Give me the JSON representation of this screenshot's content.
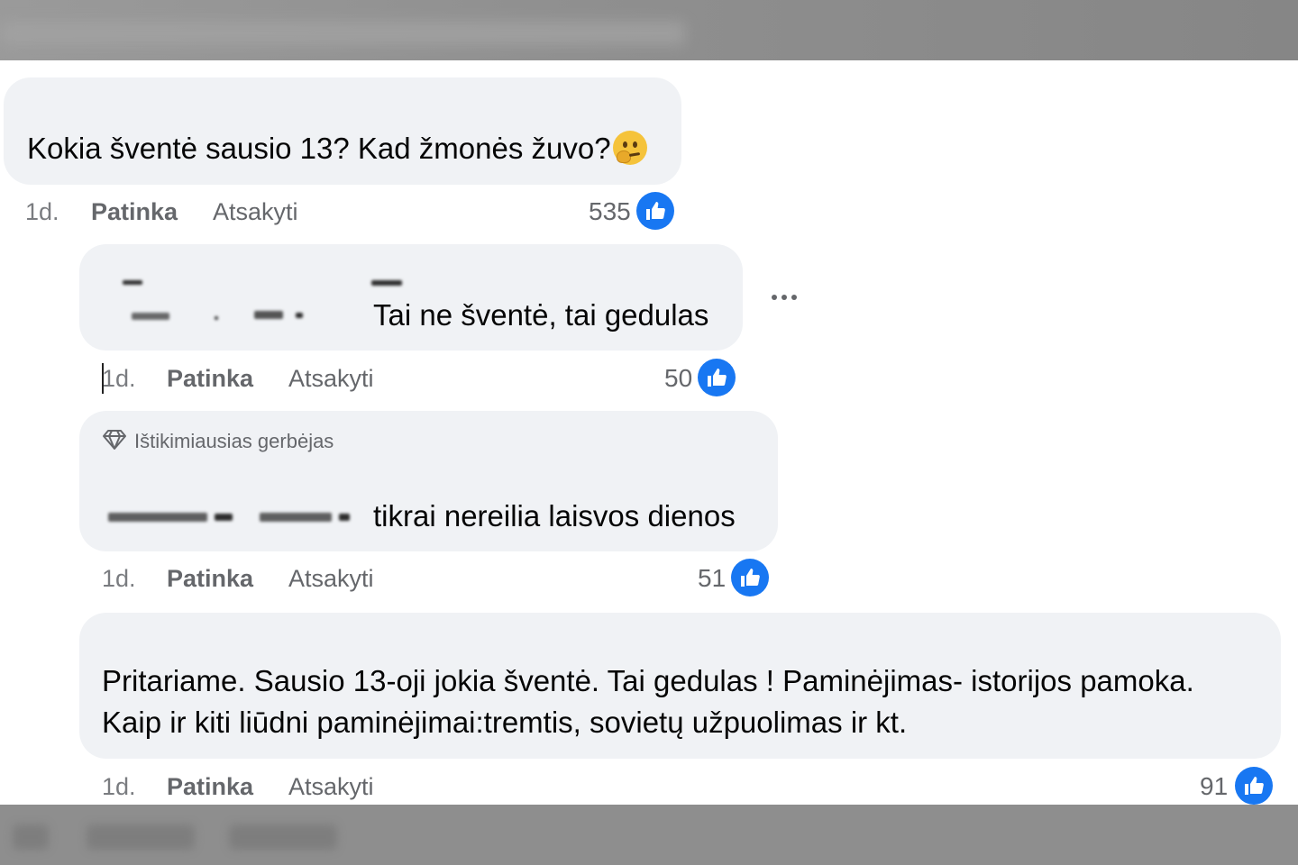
{
  "comments": [
    {
      "text": "Kokia šventė sausio 13? Kad žmonės žuvo?",
      "emoji": "thinking-face-icon",
      "time": "1d.",
      "like_label": "Patinka",
      "reply_label": "Atsakyti",
      "like_count": "535"
    },
    {
      "text": "Tai ne šventė, tai gedulas",
      "time": "1d.",
      "like_label": "Patinka",
      "reply_label": "Atsakyti",
      "like_count": "50",
      "more_label": "···"
    },
    {
      "badge": "Ištikimiausias gerbėjas",
      "text": "tikrai nereilia laisvos dienos",
      "time": "1d.",
      "like_label": "Patinka",
      "reply_label": "Atsakyti",
      "like_count": "51"
    },
    {
      "text_line1": "Pritariame. Sausio 13-oji jokia šventė. Tai gedulas ! Paminėjimas- istorijos pamoka.",
      "text_line2": "Kaip ir kiti liūdni paminėjimai:tremtis, sovietų užpuolimas ir kt.",
      "time": "1d.",
      "like_label": "Patinka",
      "reply_label": "Atsakyti",
      "like_count": "91"
    }
  ],
  "colors": {
    "bubble": "#f0f2f5",
    "meta_text": "#65676b",
    "like_blue": "#1877f2"
  }
}
